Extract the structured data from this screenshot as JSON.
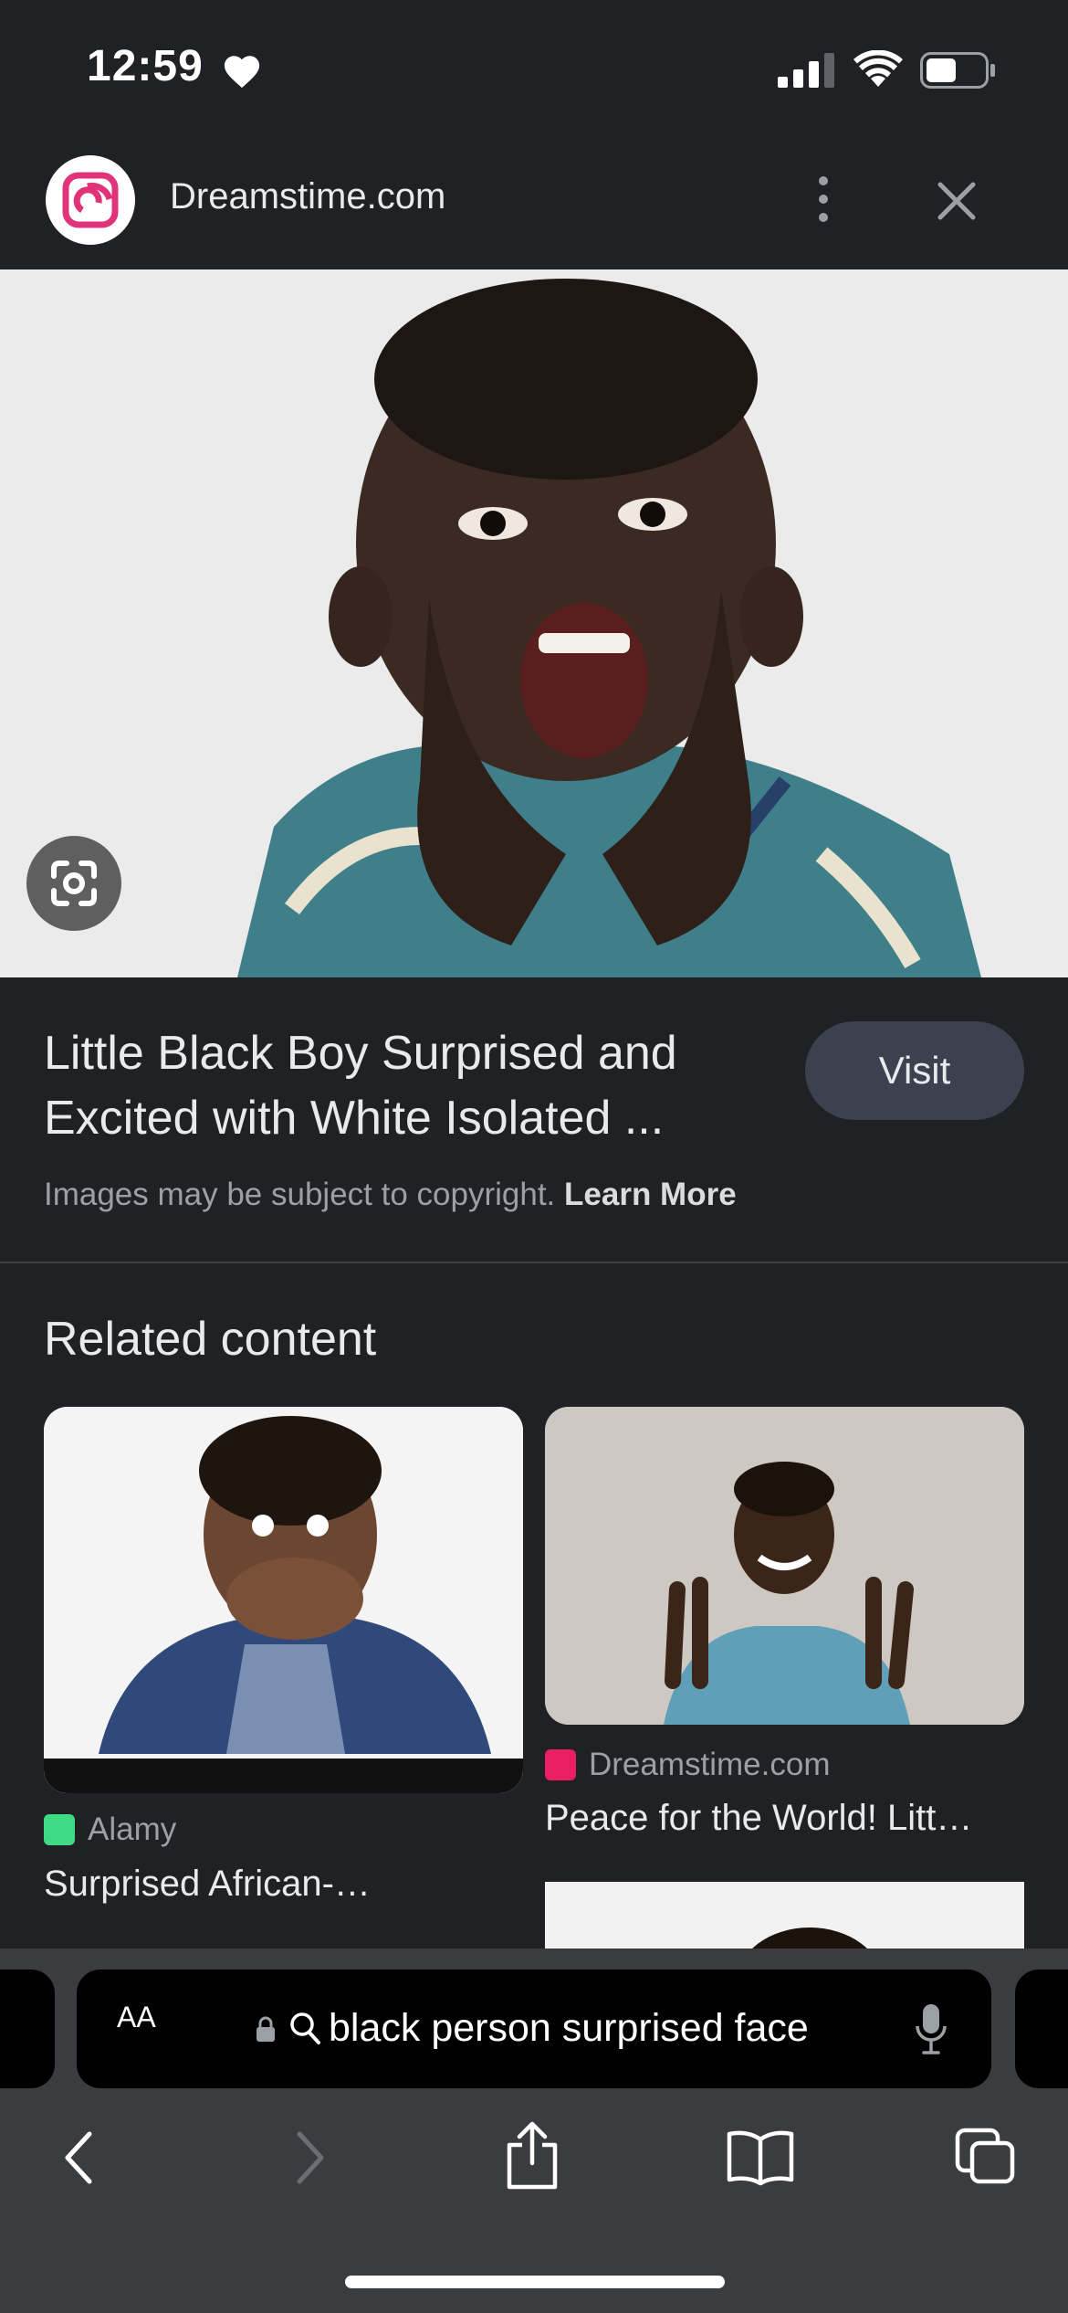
{
  "status_bar": {
    "time": "12:59"
  },
  "header": {
    "site_name": "Dreamstime.com"
  },
  "result": {
    "title_line1": "Little Black Boy Surprised and",
    "title_line2": "Excited with White Isolated ...",
    "visit_label": "Visit",
    "copyright_text": "Images may be subject to copyright.",
    "learn_more_label": "Learn More"
  },
  "related": {
    "heading": "Related content",
    "cards": [
      {
        "source": "Alamy",
        "caption": "Surprised African-…",
        "favicon_color": "#3ddc84"
      },
      {
        "source": "Dreamstime.com",
        "caption": "Peace for the World! Litt…",
        "favicon_color": "#e91e63"
      }
    ]
  },
  "address_bar": {
    "aa_label": "AA",
    "query": "black person surprised face"
  },
  "colors": {
    "background": "#202124",
    "visit_button": "#3c4150",
    "brand_pink": "#e0337a"
  }
}
